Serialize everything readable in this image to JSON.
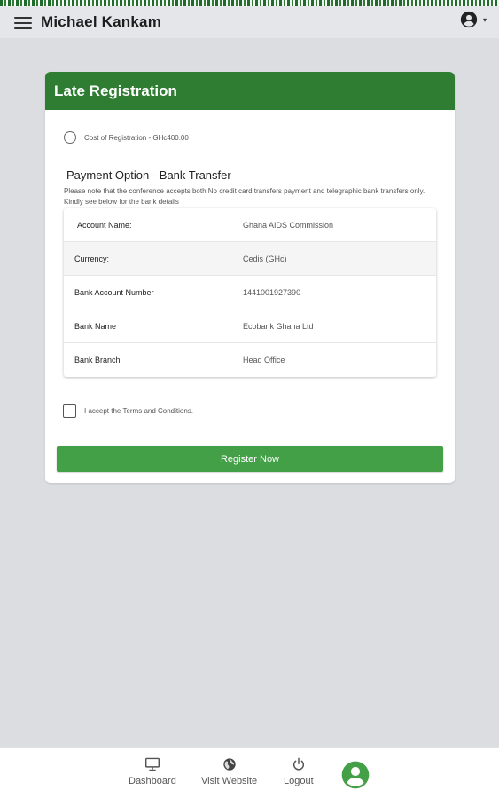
{
  "app_bar": {
    "title": "Michael Kankam",
    "menu_icon": "menu-icon",
    "account_icon": "account-circle-icon",
    "account_caret": "▾"
  },
  "card": {
    "title": "Late Registration",
    "header_color": "#2e7d32",
    "registration_option": {
      "label": "Cost of Registration - GHc400.00",
      "selected": false
    },
    "payment_title": "Payment Option - Bank Transfer",
    "payment_note": "Please note that the conference accepts both No credit card transfers payment and telegraphic bank transfers only. Kindly see below for the bank details",
    "bank_details": [
      {
        "label": "Account Name:",
        "value": "Ghana AIDS Commission"
      },
      {
        "label": "Currency:",
        "value": "Cedis (GHc)"
      },
      {
        "label": "Bank Account Number",
        "value": "1441001927390"
      },
      {
        "label": "Bank Name",
        "value": "Ecobank Ghana Ltd"
      },
      {
        "label": "Bank Branch",
        "value": "Head Office"
      }
    ],
    "terms": {
      "label": "I accept the Terms and Conditions.",
      "checked": false
    },
    "register_button": {
      "label": "Register Now",
      "color": "#43a047"
    }
  },
  "bottom_nav": {
    "items": [
      {
        "label": "Dashboard",
        "icon": "monitor-icon"
      },
      {
        "label": "Visit Website",
        "icon": "globe-icon"
      },
      {
        "label": "Logout",
        "icon": "power-icon"
      }
    ],
    "profile_icon": "account-circle-icon",
    "profile_color": "#43a047"
  }
}
